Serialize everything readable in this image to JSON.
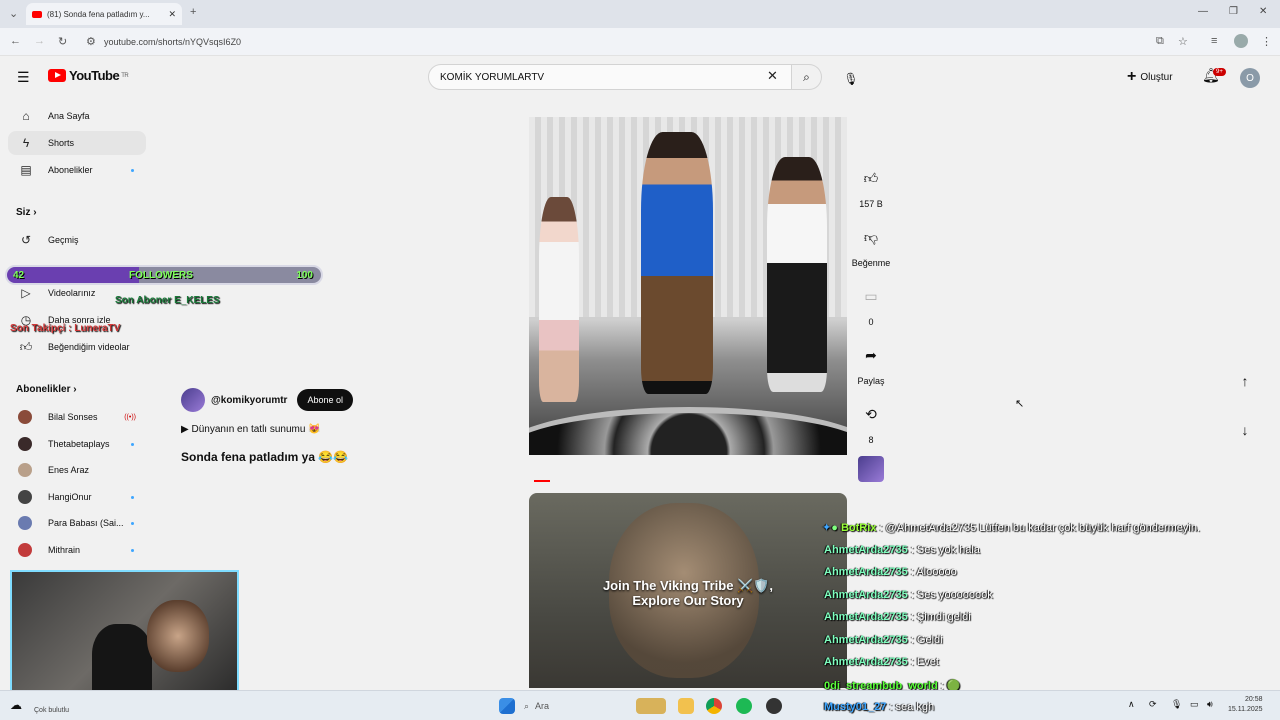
{
  "browser": {
    "tab_title": "(81) Sonda fena patladım y...",
    "url": "youtube.com/shorts/nYQVsqsI6Z0"
  },
  "header": {
    "logo_text": "YouTube",
    "region": "TR",
    "search_value": "KOMİK YORUMLARTV",
    "create_label": "Oluştur",
    "notif_count": "9+",
    "avatar_letter": "O"
  },
  "sidebar": {
    "main": [
      {
        "label": "Ana Sayfa",
        "icon": "home-icon"
      },
      {
        "label": "Shorts",
        "icon": "shorts-icon"
      },
      {
        "label": "Abonelikler",
        "icon": "subscriptions-icon"
      }
    ],
    "you_heading": "Siz",
    "you_items": [
      {
        "label": "Geçmiş",
        "icon": "history-icon"
      },
      {
        "label": "Videolarınız",
        "icon": "your-videos-icon"
      },
      {
        "label": "Daha sonra izle",
        "icon": "watch-later-icon"
      },
      {
        "label": "Beğendiğim videolar",
        "icon": "liked-icon"
      }
    ],
    "subs_heading": "Abonelikler",
    "channels": [
      {
        "label": "Bilal Sonses",
        "color": "#8a4b3a",
        "status": "live"
      },
      {
        "label": "Thetabetaplays",
        "color": "#3a2a2a",
        "status": "dot"
      },
      {
        "label": "Enes Araz",
        "color": "#b9a08a",
        "status": "none"
      },
      {
        "label": "HangiOnur",
        "color": "#444444",
        "status": "dot"
      },
      {
        "label": "Para Babası (Sai...",
        "color": "#6a7bb0",
        "status": "dot"
      },
      {
        "label": "Mithrain",
        "color": "#c23b3b",
        "status": "dot"
      }
    ]
  },
  "short": {
    "channel": "@komikyorumtr",
    "subscribe": "Abone ol",
    "description": "▶ Dünyanın en tatlı sunumu 😻",
    "title": "Sonda fena patladım ya 😂😂",
    "likes": "157 B",
    "dislike_label": "Beğenme",
    "comments": "0",
    "share_label": "Paylaş",
    "remix_count": "8",
    "next_caption_1": "Join The Viking Tribe ⚔️🛡️,",
    "next_caption_2": "Explore Our Story"
  },
  "overlay": {
    "followers_current": "42",
    "followers_label": "FOLLOWERS",
    "followers_goal": "100",
    "followers_progress": 0.42,
    "last_sub": "Son Aboner E_KELES",
    "last_follower": "Son Takipçi : LuneraTV"
  },
  "chat": [
    {
      "user": "BotRix",
      "msg": " : @AhmetArda2735 Lütfen bu kadar çok büyük harf göndermeyin."
    },
    {
      "user": "AhmetArda2735",
      "msg": " : Ses yok hala"
    },
    {
      "user": "AhmetArda2735",
      "msg": " : Alooooo"
    },
    {
      "user": "AhmetArda2735",
      "msg": " : Ses yoooooook"
    },
    {
      "user": "AhmetArda2735",
      "msg": " : Şimdi geldi"
    },
    {
      "user": "AhmetArda2735",
      "msg": " : Geldi"
    },
    {
      "user": "AhmetArda2735",
      "msg": " : Evet"
    },
    {
      "user": "0di_streambub_world",
      "msg": " : 🟢"
    },
    {
      "user": "Musty01_27",
      "msg": " : sea kgh"
    }
  ],
  "taskbar": {
    "search_placeholder": "Ara",
    "weather": "Çok bulutlu",
    "time": "20:58",
    "date": "15.11.2025"
  }
}
